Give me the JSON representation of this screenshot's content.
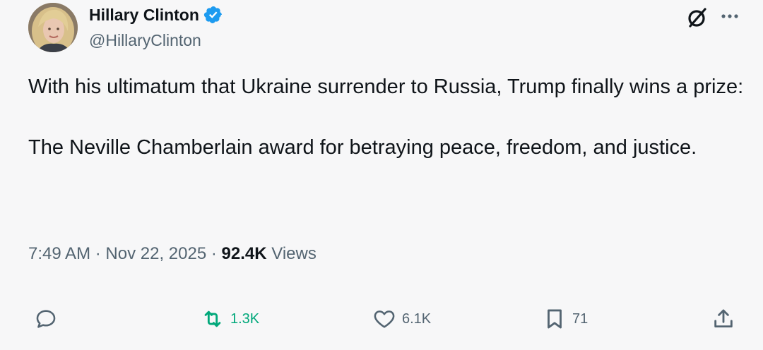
{
  "author": {
    "display_name": "Hillary Clinton",
    "handle": "@HillaryClinton",
    "verified_color": "#1d9bf0"
  },
  "tweet": {
    "paragraphs": [
      "With his ultimatum that Ukraine surrender to Russia, Trump finally wins a prize:",
      "The Neville Chamberlain award for betraying peace, freedom, and justice."
    ]
  },
  "meta": {
    "time": "7:49 AM",
    "separator": "·",
    "date": "Nov 22, 2025",
    "views_count": "92.4K",
    "views_label": "Views"
  },
  "actions": {
    "reply": {
      "icon": "reply-icon"
    },
    "retweet": {
      "icon": "retweet-icon",
      "count": "1.3K",
      "color": "#00a87a"
    },
    "like": {
      "icon": "heart-icon",
      "count": "6.1K"
    },
    "bookmark": {
      "icon": "bookmark-icon",
      "count": "71"
    },
    "share": {
      "icon": "share-icon"
    }
  },
  "header_icons": [
    "grok-icon",
    "more-icon"
  ]
}
